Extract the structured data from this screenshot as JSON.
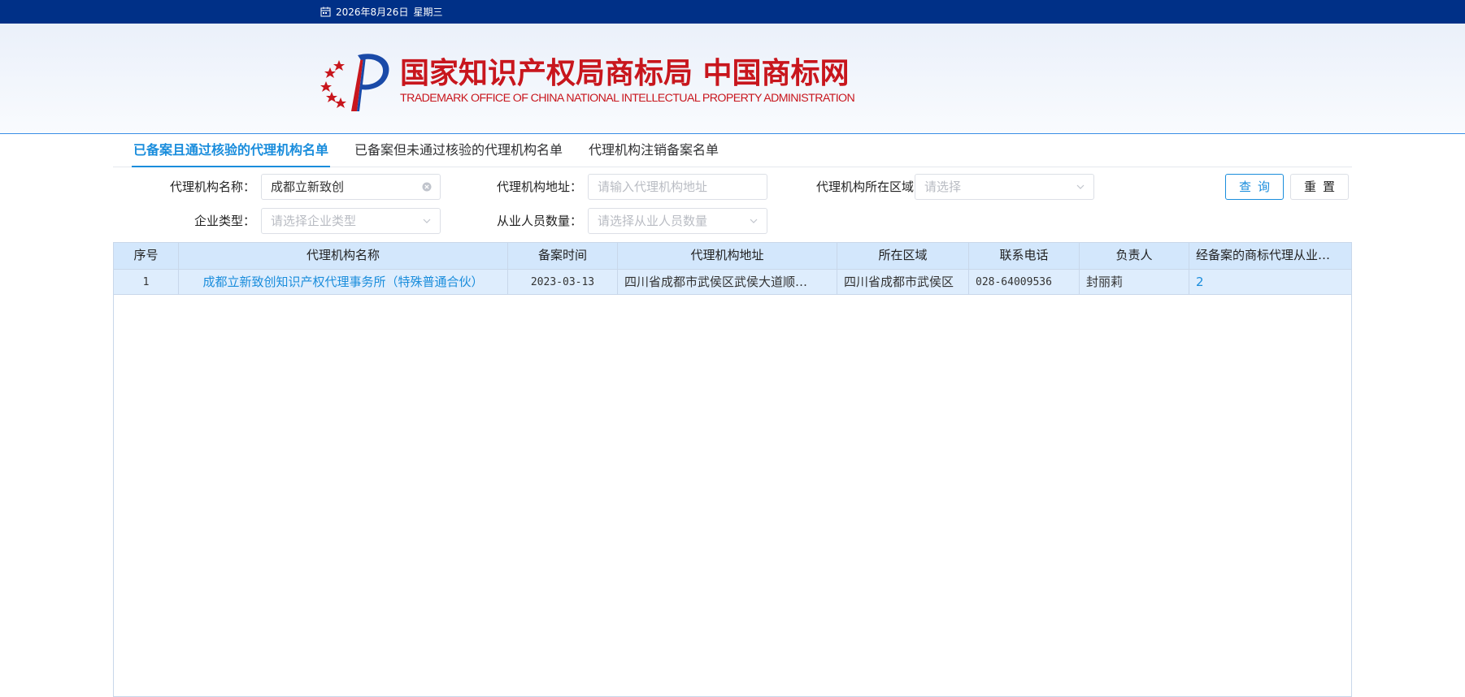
{
  "topbar": {
    "date": "2026年8月26日",
    "weekday": "星期三"
  },
  "header": {
    "title_cn": "国家知识产权局商标局 中国商标网",
    "title_en": "TRADEMARK OFFICE OF CHINA NATIONAL INTELLECTUAL PROPERTY ADMINISTRATION"
  },
  "tabs": [
    {
      "label": "已备案且通过核验的代理机构名单",
      "active": true
    },
    {
      "label": "已备案但未通过核验的代理机构名单",
      "active": false
    },
    {
      "label": "代理机构注销备案名单",
      "active": false
    }
  ],
  "form": {
    "name_label": "代理机构名称：",
    "name_value": "成都立新致创",
    "address_label": "代理机构地址：",
    "address_placeholder": "请输入代理机构地址",
    "region_label": "代理机构所在区域：",
    "region_placeholder": "请选择",
    "type_label": "企业类型：",
    "type_placeholder": "请选择企业类型",
    "staff_label": "从业人员数量：",
    "staff_placeholder": "请选择从业人员数量",
    "query_button": "查询",
    "reset_button": "重置"
  },
  "table": {
    "columns": [
      "序号",
      "代理机构名称",
      "备案时间",
      "代理机构地址",
      "所在区域",
      "联系电话",
      "负责人",
      "经备案的商标代理从业…"
    ],
    "rows": [
      {
        "index": "1",
        "name": "成都立新致创知识产权代理事务所（特殊普通合伙）",
        "date": "2023-03-13",
        "address": "四川省成都市武侯区武侯大道顺…",
        "region": "四川省成都市武侯区",
        "phone": "028-64009536",
        "person": "封丽莉",
        "staff_count": "2"
      }
    ]
  },
  "colors": {
    "topbar": "#003087",
    "accent": "#1a8ddc",
    "brand_red": "#c8161d",
    "header_row": "#d3e7fc",
    "body_row": "#deedfd"
  },
  "icons": {
    "date": "calendar-icon",
    "clear": "clear-circle-icon",
    "select": "chevron-down-icon"
  }
}
